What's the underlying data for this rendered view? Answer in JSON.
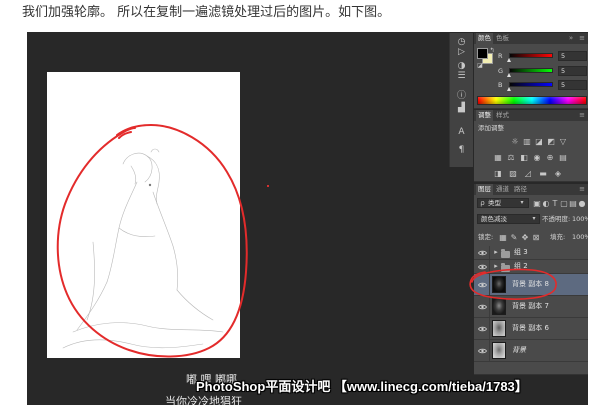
{
  "article": {
    "caption": "我们加强轮廓。 所以在复制一遍滤镜处理过后的图片。如下图。"
  },
  "colors": {
    "annotation_red": "#e32b2b",
    "canvas_bg": "#282828",
    "panel_bg": "#4a4a4a",
    "selected_layer": "#5d6a80"
  },
  "toolbar": {
    "icons": [
      "history-icon",
      "actions-icon",
      "adjustments-icon",
      "properties-icon",
      "info-icon",
      "histogram-icon",
      "character-icon",
      "paragraph-icon"
    ]
  },
  "color_panel": {
    "tabs": [
      "颜色",
      "色板"
    ],
    "foreground": "#000000",
    "background": "#f3efb4",
    "channels": [
      {
        "label": "R",
        "value": 5
      },
      {
        "label": "G",
        "value": 5
      },
      {
        "label": "B",
        "value": 5
      }
    ],
    "channel_max": 255
  },
  "adjustments_panel": {
    "tabs": [
      "调整",
      "样式"
    ],
    "title": "添加调整",
    "icon_rows": [
      [
        "brightness-contrast-icon",
        "levels-icon",
        "curves-icon",
        "exposure-icon",
        "vibrance-icon"
      ],
      [
        "hue-saturation-icon",
        "color-balance-icon",
        "black-white-icon",
        "photo-filter-icon",
        "channel-mixer-icon",
        "color-lookup-icon"
      ],
      [
        "invert-icon",
        "posterize-icon",
        "threshold-icon",
        "gradient-map-icon",
        "selective-color-icon"
      ]
    ]
  },
  "layers_panel": {
    "tabs": [
      "图层",
      "通道",
      "路径"
    ],
    "filter_kind": "类型",
    "filter_icons": [
      "pixel-layer-filter-icon",
      "adjustment-layer-filter-icon",
      "type-layer-filter-icon",
      "shape-layer-filter-icon",
      "smart-object-filter-icon",
      "filter-toggle-icon"
    ],
    "blend_mode": "颜色减淡",
    "opacity_label": "不透明度:",
    "opacity": "100%",
    "lock_label": "锁定:",
    "lock_icons": [
      "lock-transparent-pixels-icon",
      "lock-image-pixels-icon",
      "lock-position-icon",
      "lock-all-icon"
    ],
    "fill_label": "填充:",
    "fill": "100%",
    "selected_index": 2,
    "layers": [
      {
        "name": "组 3"
      },
      {
        "name": "组 2"
      },
      {
        "name": "背景 副本 8"
      },
      {
        "name": "背景 副本 7"
      },
      {
        "name": "背景 副本 6"
      },
      {
        "name": "背景"
      }
    ]
  },
  "overlay": {
    "lyric_top": "嘟 哩 嘟哪",
    "watermark": "PhotoShop平面设计吧 【www.linecg.com/tieba/1783】",
    "lyric_bottom": "当你冷冷地猖狂"
  }
}
